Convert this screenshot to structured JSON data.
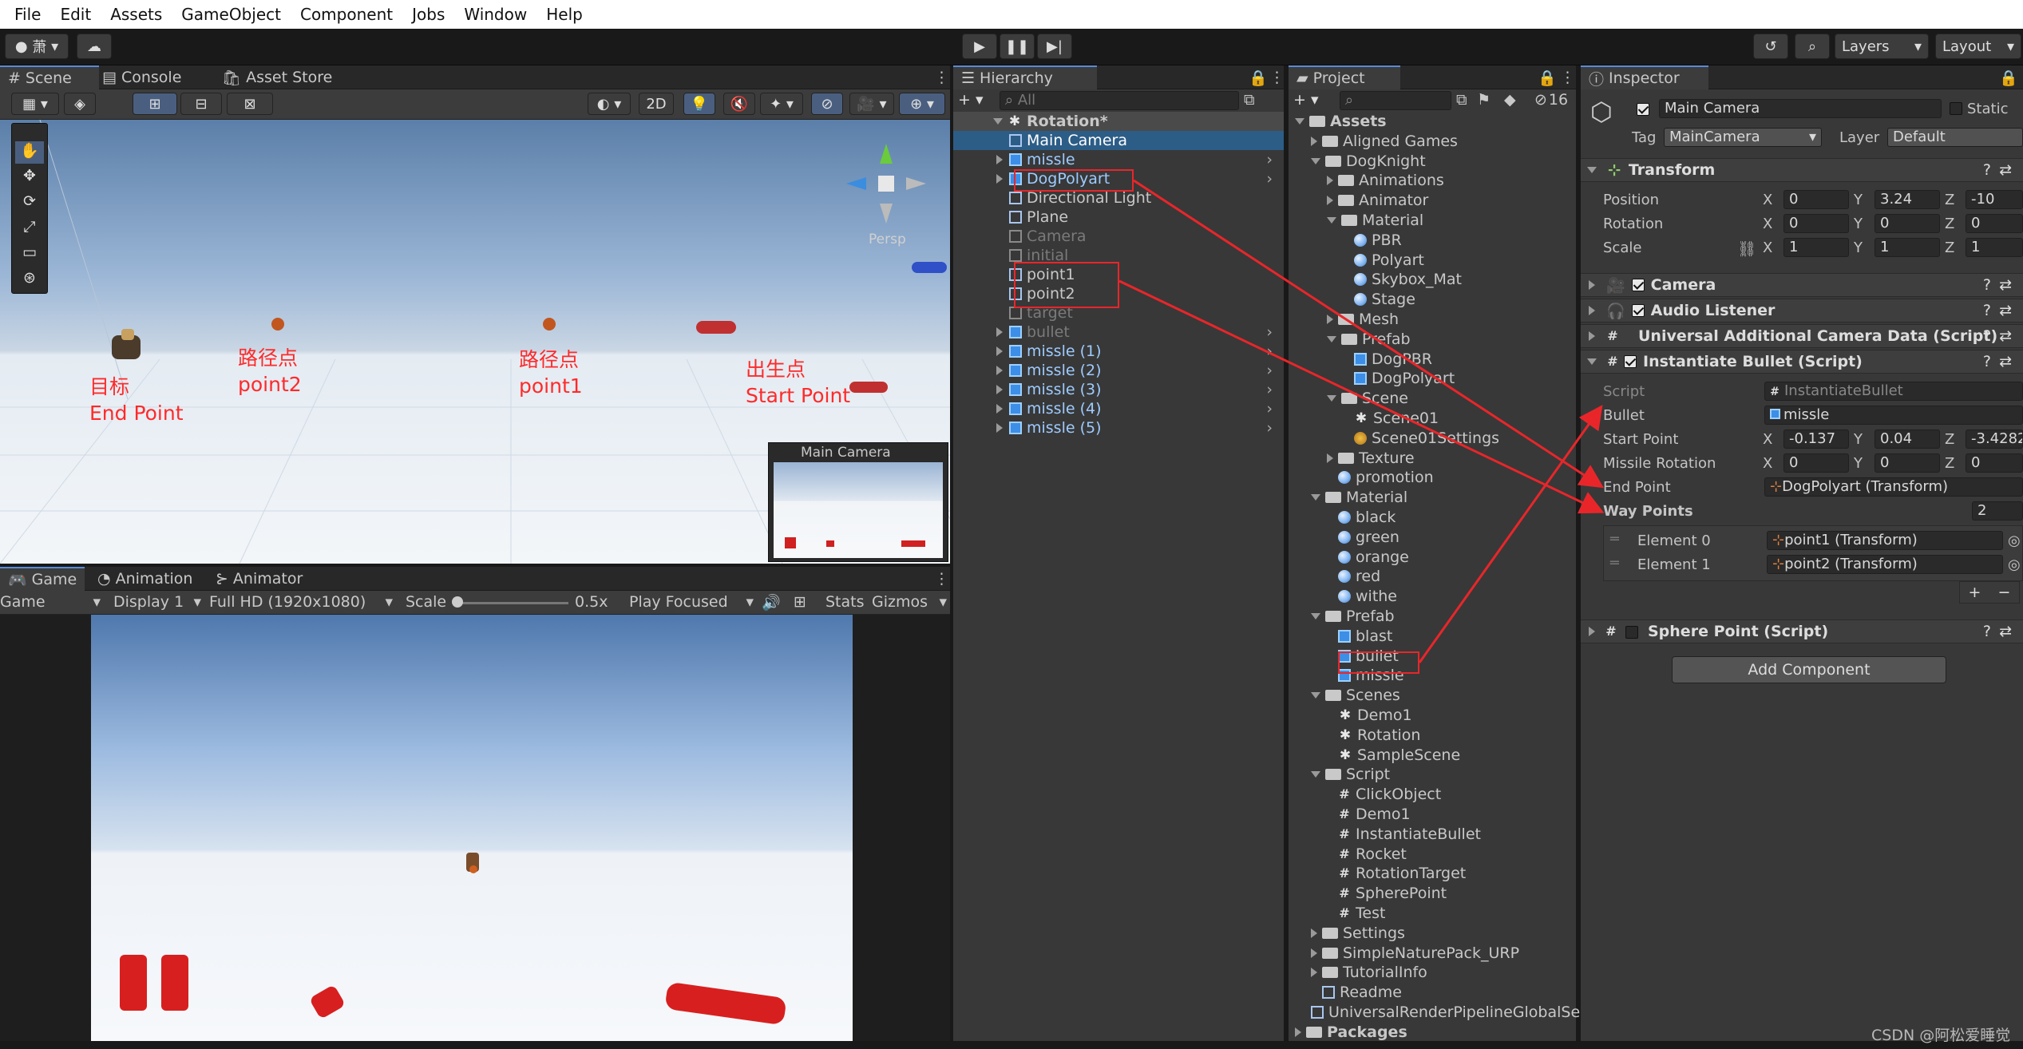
{
  "menu": [
    "File",
    "Edit",
    "Assets",
    "GameObject",
    "Component",
    "Jobs",
    "Window",
    "Help"
  ],
  "toolbar": {
    "account_label": "萧",
    "layers": "Layers",
    "layout": "Layout"
  },
  "scene_tabs": [
    "Scene",
    "Console",
    "Asset Store"
  ],
  "scene_toolbar": {
    "mode_2d": "2D"
  },
  "scene_labels": {
    "target": "目标\nEnd Point",
    "path2": "路径点\npoint2",
    "path1": "路径点\npoint1",
    "spawn": "出生点\nStart Point",
    "persp": "Persp",
    "camera_preview_title": "Main Camera"
  },
  "game_tabs": [
    "Game",
    "Animation",
    "Animator"
  ],
  "game_toolbar": {
    "view": "Game",
    "display": "Display 1",
    "resolution": "Full HD (1920x1080)",
    "scale_label": "Scale",
    "scale_value": "0.5x",
    "play_mode": "Play Focused",
    "stats": "Stats",
    "gizmos": "Gizmos"
  },
  "hierarchy": {
    "title": "Hierarchy",
    "search_placeholder": "All",
    "scene": "Rotation*",
    "items": [
      "Main Camera",
      "missle",
      "DogPolyart",
      "Directional Light",
      "Plane",
      "Camera",
      "initial",
      "point1",
      "point2",
      "target",
      "bullet",
      "missle (1)",
      "missle (2)",
      "missle (3)",
      "missle (4)",
      "missle (5)"
    ]
  },
  "project": {
    "title": "Project",
    "badge": "16",
    "items": [
      "Assets",
      "Aligned Games",
      "DogKnight",
      "Animations",
      "Animator",
      "Material",
      "PBR",
      "Polyart",
      "Skybox_Mat",
      "Stage",
      "Mesh",
      "Prefab",
      "DogPBR",
      "DogPolyart",
      "Scene",
      "Scene01",
      "Scene01Settings",
      "Texture",
      "promotion",
      "Material",
      "black",
      "green",
      "orange",
      "red",
      "withe",
      "Prefab",
      "blast",
      "bullet",
      "missle",
      "Scenes",
      "Demo1",
      "Rotation",
      "SampleScene",
      "Script",
      "ClickObject",
      "Demo1",
      "InstantiateBullet",
      "Rocket",
      "RotationTarget",
      "SpherePoint",
      "Test",
      "Settings",
      "SimpleNaturePack_URP",
      "TutorialInfo",
      "Readme",
      "UniversalRenderPipelineGlobalSe",
      "Packages"
    ]
  },
  "inspector": {
    "title": "Inspector",
    "object_name": "Main Camera",
    "static_label": "Static",
    "tag_label": "Tag",
    "tag_value": "MainCamera",
    "layer_label": "Layer",
    "layer_value": "Default",
    "transform": {
      "header": "Transform",
      "position_label": "Position",
      "pos": [
        "0",
        "3.24",
        "-10"
      ],
      "rotation_label": "Rotation",
      "rot": [
        "0",
        "0",
        "0"
      ],
      "scale_label": "Scale",
      "scl": [
        "1",
        "1",
        "1"
      ]
    },
    "components": [
      "Camera",
      "Audio Listener",
      "Universal Additional Camera Data (Script)",
      "Instantiate Bullet (Script)"
    ],
    "script_fields": {
      "script_label": "Script",
      "script_value": "InstantiateBullet",
      "bullet_label": "Bullet",
      "bullet_value": "missle",
      "start_label": "Start Point",
      "start": [
        "-0.137",
        "0.04",
        "-3.4282"
      ],
      "missile_rot_label": "Missile Rotation",
      "missile_rot": [
        "0",
        "0",
        "0"
      ],
      "end_label": "End Point",
      "end_value": "DogPolyart (Transform)",
      "way_label": "Way Points",
      "way_count": "2",
      "el0_label": "Element 0",
      "el0_value": "point1 (Transform)",
      "el1_label": "Element 1",
      "el1_value": "point2 (Transform)"
    },
    "sphere_point": "Sphere Point (Script)",
    "add_component": "Add Component"
  },
  "watermark": "CSDN @阿松爱睡觉",
  "colors": {
    "accent": "#2c5d87",
    "annotation": "#e8262a",
    "sky_top": "#9ab4d4",
    "ground": "#e9eef4"
  }
}
